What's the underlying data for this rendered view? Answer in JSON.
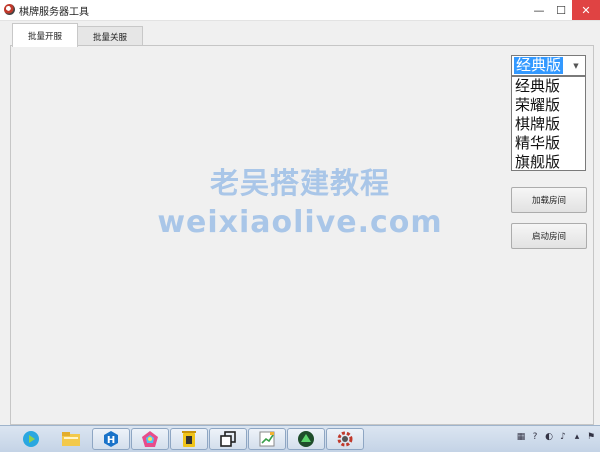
{
  "window": {
    "title": "棋牌服务器工具",
    "controls": {
      "minimize": "—",
      "maximize": "☐",
      "close": "✕"
    }
  },
  "tabs": [
    {
      "label": "批量开服",
      "active": true
    },
    {
      "label": "批量关服",
      "active": false
    }
  ],
  "combo": {
    "selected": "经典版",
    "options": [
      "经典版",
      "荣耀版",
      "棋牌版",
      "精华版",
      "旗舰版"
    ]
  },
  "buttons": {
    "load_rooms": "加载房间",
    "start_rooms": "启动房间"
  },
  "watermark": {
    "line1": "老吴搭建教程",
    "line2": "weixiaolive.com"
  },
  "taskbar": {
    "apps": [
      "media-player-icon",
      "file-explorer-icon",
      "h-app-icon",
      "colorful-app-icon",
      "trash-app-icon",
      "window-switch-icon",
      "editor-icon",
      "green-app-icon",
      "gear-app-icon"
    ]
  },
  "colors": {
    "selection": "#3399ff",
    "close": "#e04343",
    "watermark": "#a9c6e8"
  }
}
